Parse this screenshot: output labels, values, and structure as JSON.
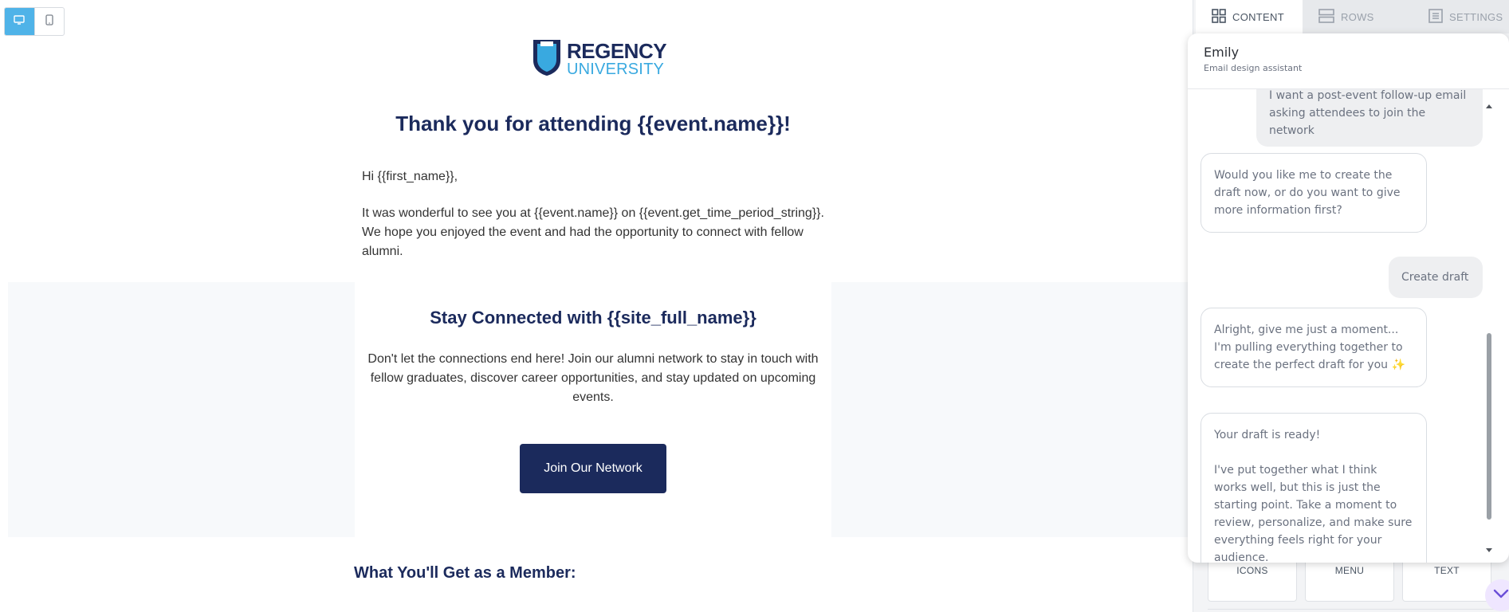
{
  "device_toggle": {
    "desktop_icon": "monitor-icon",
    "mobile_icon": "phone-icon",
    "selected": "desktop"
  },
  "email": {
    "logo": {
      "line1": "REGENCY",
      "line2": "UNIVERSITY",
      "icon": "shield-icon"
    },
    "heading": "Thank you for attending {{event.name}}!",
    "greeting": "Hi {{first_name}},",
    "paragraph": "It was wonderful to see you at {{event.name}} on {{event.get_time_period_string}}. We hope you enjoyed the event and had the opportunity to connect with fellow alumni.",
    "stay_title": "Stay Connected with {{site_full_name}}",
    "stay_body": "Don't let the connections end here! Join our alumni network to stay in touch with fellow graduates, discover career opportunities, and stay updated on upcoming events.",
    "cta_label": "Join Our Network",
    "member_title": "What You'll Get as a Member:"
  },
  "sidebar": {
    "tabs": [
      {
        "label": "CONTENT",
        "icon": "grid-icon",
        "active": true
      },
      {
        "label": "ROWS",
        "icon": "rows-icon",
        "active": false
      },
      {
        "label": "SETTINGS",
        "icon": "settings-icon",
        "active": false
      }
    ],
    "blocks": [
      {
        "label": "ICONS"
      },
      {
        "label": "MENU"
      },
      {
        "label": "TEXT"
      }
    ]
  },
  "chat": {
    "assistant_name": "Emily",
    "assistant_role": "Email design assistant",
    "messages": [
      {
        "from": "user",
        "text": "I want a post-event follow-up email asking attendees to join the network"
      },
      {
        "from": "bot",
        "text": "Would you like me to create the draft now, or do you want to give more information first?"
      },
      {
        "from": "user",
        "text": "Create draft"
      },
      {
        "from": "bot",
        "text": "Alright, give me just a moment... I'm pulling everything together to create the perfect draft for you ✨"
      },
      {
        "from": "bot",
        "line1": "Your draft is ready!",
        "line2": "I've put together what I think works well, but this is just the starting point. Take a moment to review, personalize, and make sure everything feels right for your audience."
      }
    ]
  },
  "colors": {
    "navy": "#1b2a5c",
    "accent_blue": "#4fb3e8",
    "logo_light_blue": "#39a9e0"
  }
}
